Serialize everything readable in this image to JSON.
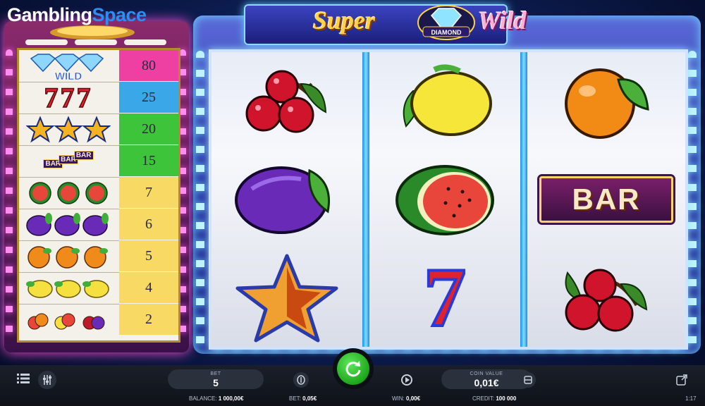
{
  "watermark": {
    "part1": "Gambling",
    "part2": "Space"
  },
  "game": {
    "logo_left": "Super",
    "logo_right": "Wild",
    "logo_badge": "DIAMOND"
  },
  "paytable": {
    "rows": [
      {
        "symbol": "diamond-wild",
        "label": "WILD",
        "payout": "80",
        "color": "#ee3fa3"
      },
      {
        "symbol": "seven",
        "label": "777",
        "payout": "25",
        "color": "#3aa8e8"
      },
      {
        "symbol": "star",
        "payout": "20",
        "color": "#3ec43a"
      },
      {
        "symbol": "bar",
        "label": "BAR",
        "payout": "15",
        "color": "#3ec43a"
      },
      {
        "symbol": "watermelon",
        "payout": "7",
        "color": "#f7d963"
      },
      {
        "symbol": "plum",
        "payout": "6",
        "color": "#f7d963"
      },
      {
        "symbol": "orange",
        "payout": "5",
        "color": "#f7d963"
      },
      {
        "symbol": "lemon",
        "payout": "4",
        "color": "#f7d963"
      },
      {
        "symbol": "any-fruit",
        "payout": "2",
        "color": "#f7d963"
      }
    ]
  },
  "reels": [
    [
      "cherry",
      "plum",
      "star"
    ],
    [
      "lemon",
      "watermelon",
      "seven"
    ],
    [
      "orange",
      "bar",
      "cherry"
    ]
  ],
  "reel_bar_label": "BAR",
  "controls": {
    "bet_label": "BET",
    "bet_value": "5",
    "coin_label": "COIN VALUE",
    "coin_value": "0,01€",
    "time": "1:17"
  },
  "status": {
    "balance_label": "BALANCE:",
    "balance_value": "1 000,00€",
    "bet_label": "BET:",
    "bet_value": "0,05€",
    "win_label": "WIN:",
    "win_value": "0,00€",
    "credit_label": "CREDIT:",
    "credit_value": "100 000"
  }
}
